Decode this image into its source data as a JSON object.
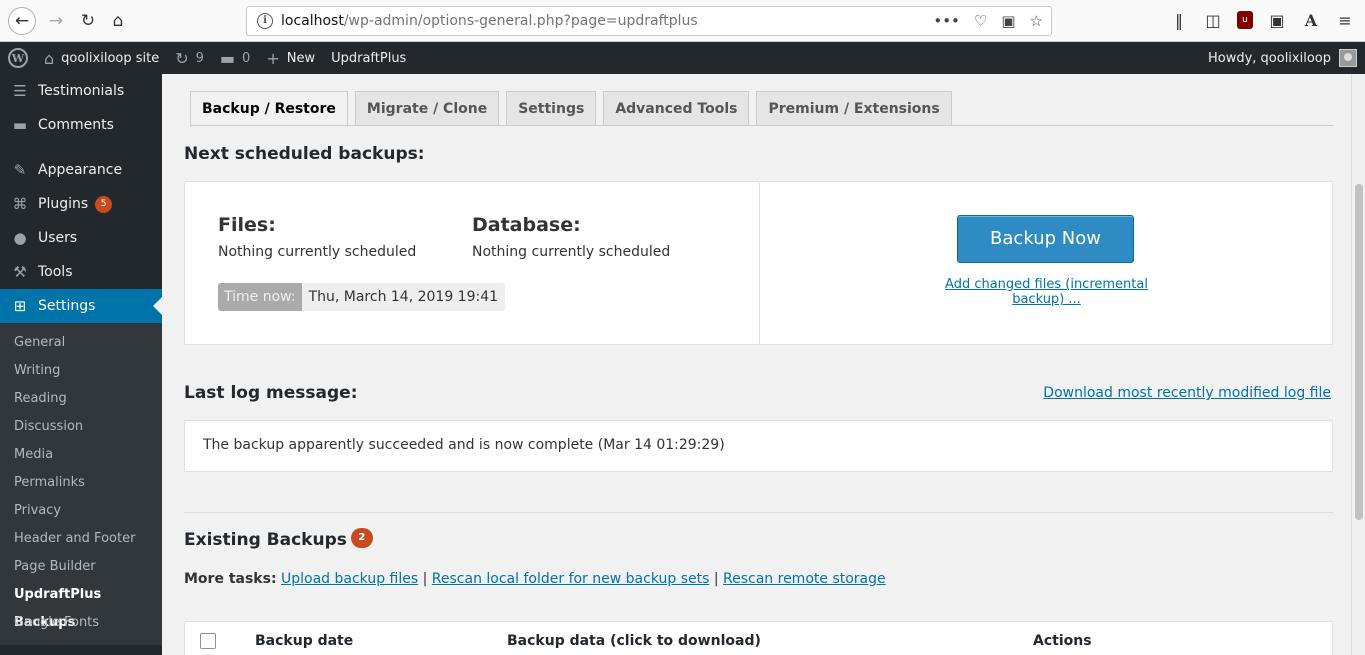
{
  "browser": {
    "url_host": "localhost",
    "url_path": "/wp-admin/options-general.php?page=updraftplus",
    "more_glyph": "•••"
  },
  "adminbar": {
    "site_name": "qoolixiloop site",
    "updates_count": "9",
    "comments_count": "0",
    "new_label": "New",
    "plugin_label": "UpdraftPlus",
    "howdy": "Howdy, qoolixiloop"
  },
  "sidebar": {
    "items": [
      {
        "label": "Testimonials",
        "icon": "testimonial-icon"
      },
      {
        "label": "Comments",
        "icon": "comment-icon"
      },
      {
        "label": "Appearance",
        "icon": "paintbrush-icon"
      },
      {
        "label": "Plugins",
        "icon": "plugin-icon",
        "badge": "5"
      },
      {
        "label": "Users",
        "icon": "users-icon"
      },
      {
        "label": "Tools",
        "icon": "wrench-icon"
      },
      {
        "label": "Settings",
        "icon": "settings-icon"
      }
    ],
    "submenu": [
      "General",
      "Writing",
      "Reading",
      "Discussion",
      "Media",
      "Permalinks",
      "Privacy",
      "Header and Footer",
      "Page Builder",
      "UpdraftPlus Backups",
      "Google Fonts"
    ]
  },
  "tabs": [
    "Backup / Restore",
    "Migrate / Clone",
    "Settings",
    "Advanced Tools",
    "Premium / Extensions"
  ],
  "scheduled": {
    "heading": "Next scheduled backups:",
    "files_title": "Files:",
    "files_text": "Nothing currently scheduled",
    "db_title": "Database:",
    "db_text": "Nothing currently scheduled",
    "time_label": "Time now:",
    "time_value": "Thu, March 14, 2019 19:41",
    "backup_now": "Backup Now",
    "incremental_link": "Add changed files (incremental backup) ..."
  },
  "log": {
    "heading": "Last log message:",
    "download_link": "Download most recently modified log file",
    "message": "The backup apparently succeeded and is now complete (Mar 14 01:29:29)"
  },
  "existing": {
    "heading": "Existing Backups",
    "count": "2",
    "more_tasks_label": "More tasks:",
    "upload_link": "Upload backup files",
    "rescan_local_link": "Rescan local folder for new backup sets",
    "rescan_remote_link": "Rescan remote storage",
    "separator": "|",
    "columns": [
      "Backup date",
      "Backup data (click to download)",
      "Actions"
    ]
  },
  "colors": {
    "accent": "#0073aa",
    "badge": "#ca4a1f",
    "admin_dark": "#23282d",
    "button_blue": "#2e8bc4"
  }
}
